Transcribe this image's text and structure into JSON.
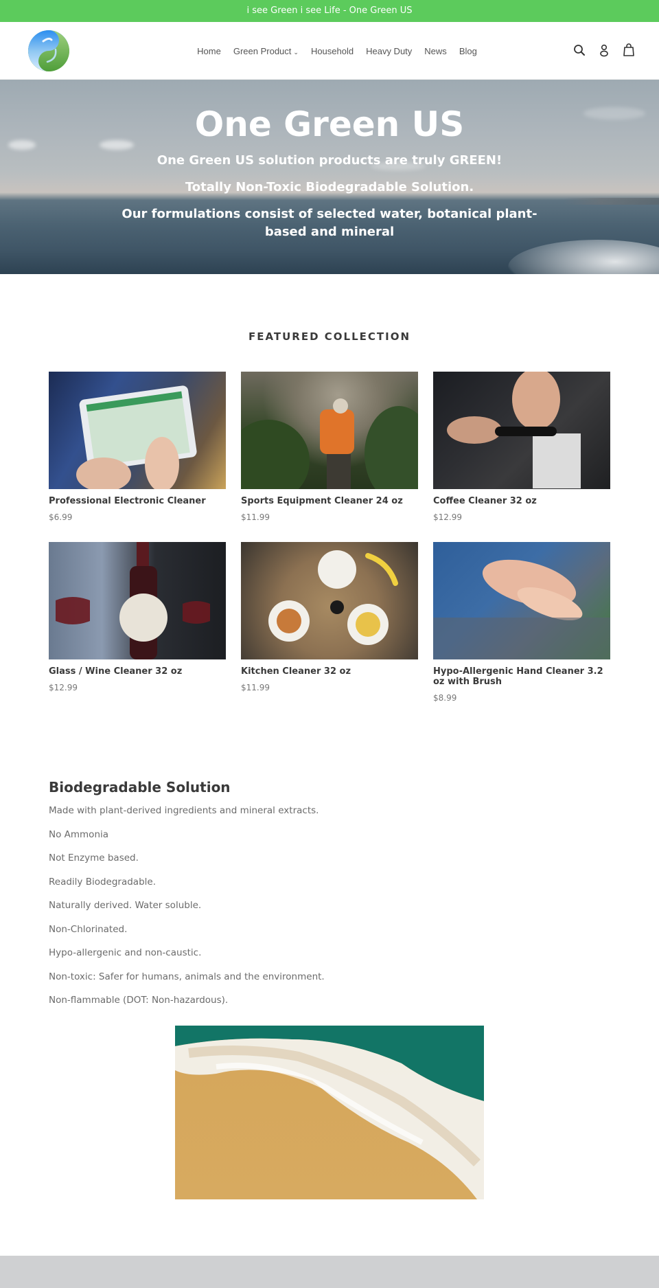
{
  "announcement": {
    "text": "i see Green i see Life - One Green US",
    "background_color": "#5ccb5c"
  },
  "header": {
    "logo_alt": "One Green US logo",
    "nav": [
      {
        "label": "Home",
        "has_dropdown": false
      },
      {
        "label": "Green Product",
        "has_dropdown": true
      },
      {
        "label": "Household",
        "has_dropdown": false
      },
      {
        "label": "Heavy Duty",
        "has_dropdown": false
      },
      {
        "label": "News",
        "has_dropdown": false
      },
      {
        "label": "Blog",
        "has_dropdown": false
      }
    ],
    "icons": [
      "search-icon",
      "account-icon",
      "cart-icon"
    ]
  },
  "hero": {
    "title": "One Green US",
    "line1": "One Green US solution products are truly GREEN!",
    "line2": "Totally Non-Toxic Biodegradable Solution.",
    "line3": "Our formulations consist of selected water, botanical plant-based and mineral"
  },
  "featured": {
    "title": "FEATURED COLLECTION",
    "products": [
      {
        "title": "Professional Electronic Cleaner",
        "price": "$6.99",
        "image": "tablet-map"
      },
      {
        "title": "Sports Equipment Cleaner 24 oz",
        "price": "$11.99",
        "image": "hiker"
      },
      {
        "title": "Coffee Cleaner 32 oz",
        "price": "$12.99",
        "image": "espresso-tamper"
      },
      {
        "title": "Glass / Wine Cleaner 32 oz",
        "price": "$12.99",
        "image": "wine-bottle"
      },
      {
        "title": "Kitchen Cleaner 32 oz",
        "price": "$11.99",
        "image": "breakfast-table"
      },
      {
        "title": "Hypo-Allergenic Hand Cleaner 3.2 oz with Brush",
        "price": "$8.99",
        "image": "child-hands"
      }
    ]
  },
  "biodegradable": {
    "title": "Biodegradable Solution",
    "items": [
      "Made with plant-derived ingredients and mineral extracts.",
      "No Ammonia",
      "Not Enzyme based.",
      "Readily Biodegradable.",
      "Naturally derived. Water soluble.",
      "Non-Chlorinated.",
      "Hypo-allergenic and non-caustic.",
      "Non-toxic: Safer for humans, animals and the environment.",
      "Non-flammable (DOT: Non-hazardous)."
    ],
    "image": "beach-wave"
  }
}
